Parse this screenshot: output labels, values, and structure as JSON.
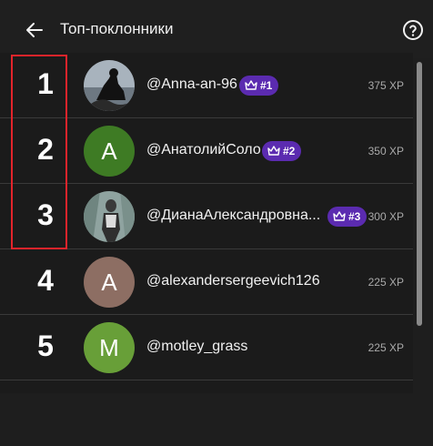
{
  "header": {
    "title": "Топ-поклонники",
    "back_icon": "arrow-left-icon",
    "help_icon": "question-circle-icon"
  },
  "colors": {
    "badge": "#5b2bb0",
    "highlight": "#e3242b"
  },
  "fans": [
    {
      "rank": "1",
      "username": "@Anna-an-96",
      "badge": "#1",
      "xp": "375 XP",
      "avatar_type": "photo"
    },
    {
      "rank": "2",
      "username": "@АнатолийСоло",
      "badge": "#2",
      "xp": "350 XP",
      "avatar_letter": "A",
      "avatar_color": "#3e7b24"
    },
    {
      "rank": "3",
      "username": "@ДианаАлександровна...",
      "badge": "#3",
      "xp": "300 XP",
      "avatar_type": "photo"
    },
    {
      "rank": "4",
      "username": "@alexandersergeevich126",
      "xp": "225 XP",
      "avatar_letter": "A",
      "avatar_color": "#8d6e63"
    },
    {
      "rank": "5",
      "username": "@motley_grass",
      "xp": "225 XP",
      "avatar_letter": "M",
      "avatar_color": "#689f38"
    }
  ]
}
